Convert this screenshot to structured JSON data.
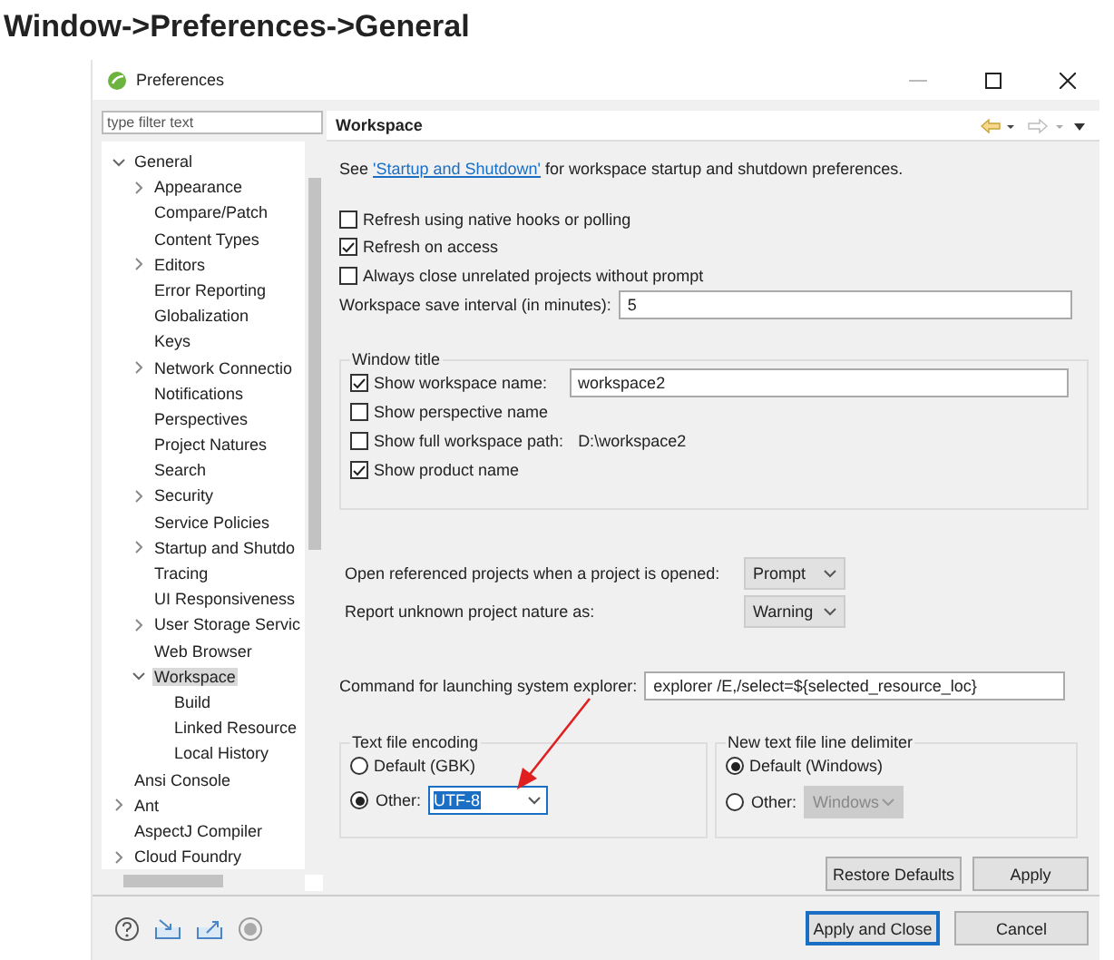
{
  "heading": "Window->Preferences->General",
  "window": {
    "title": "Preferences"
  },
  "filter": {
    "placeholder": "type filter text"
  },
  "tree": [
    {
      "label": "General",
      "expanded": true,
      "selected": false,
      "children": [
        {
          "label": "Appearance",
          "expanded": false,
          "selected": false,
          "has_children": true
        },
        {
          "label": "Compare/Patch",
          "selected": false
        },
        {
          "label": "Content Types",
          "selected": false
        },
        {
          "label": "Editors",
          "expanded": false,
          "selected": false,
          "has_children": true
        },
        {
          "label": "Error Reporting",
          "selected": false
        },
        {
          "label": "Globalization",
          "selected": false
        },
        {
          "label": "Keys",
          "selected": false
        },
        {
          "label": "Network Connectio",
          "expanded": false,
          "selected": false,
          "has_children": true
        },
        {
          "label": "Notifications",
          "selected": false
        },
        {
          "label": "Perspectives",
          "selected": false
        },
        {
          "label": "Project Natures",
          "selected": false
        },
        {
          "label": "Search",
          "selected": false
        },
        {
          "label": "Security",
          "expanded": false,
          "selected": false,
          "has_children": true
        },
        {
          "label": "Service Policies",
          "selected": false
        },
        {
          "label": "Startup and Shutdo",
          "expanded": false,
          "selected": false,
          "has_children": true
        },
        {
          "label": "Tracing",
          "selected": false
        },
        {
          "label": "UI Responsiveness",
          "selected": false
        },
        {
          "label": "User Storage Servic",
          "expanded": false,
          "selected": false,
          "has_children": true
        },
        {
          "label": "Web Browser",
          "selected": false
        },
        {
          "label": "Workspace",
          "expanded": true,
          "selected": true,
          "children": [
            {
              "label": "Build",
              "selected": false
            },
            {
              "label": "Linked Resource",
              "selected": false
            },
            {
              "label": "Local History",
              "selected": false
            }
          ]
        }
      ]
    },
    {
      "label": "Ansi Console",
      "selected": false
    },
    {
      "label": "Ant",
      "expanded": false,
      "selected": false,
      "has_children": true
    },
    {
      "label": "AspectJ Compiler",
      "selected": false
    },
    {
      "label": "Cloud Foundry",
      "expanded": false,
      "selected": false,
      "has_children": true
    }
  ],
  "page": {
    "title": "Workspace",
    "description": {
      "before": "See ",
      "link": "'Startup and Shutdown'",
      "after": " for workspace startup and shutdown preferences."
    },
    "options": [
      {
        "label": "Refresh using native hooks or polling",
        "checked": false
      },
      {
        "label": "Refresh on access",
        "checked": true
      },
      {
        "label": "Always close unrelated projects without prompt",
        "checked": false
      }
    ],
    "save_interval": {
      "label": "Workspace save interval (in minutes):",
      "value": "5"
    },
    "window_title": {
      "title": "Window title",
      "show_workspace_name": {
        "label": "Show workspace name:",
        "checked": true,
        "value": "workspace2"
      },
      "show_perspective_name": {
        "label": "Show perspective name",
        "checked": false
      },
      "show_full_path": {
        "label": "Show full workspace path:",
        "checked": false,
        "path": "D:\\workspace2"
      },
      "show_product_name": {
        "label": "Show product name",
        "checked": true
      }
    },
    "open_referenced": {
      "label": "Open referenced projects when a project is opened:",
      "value": "Prompt"
    },
    "unknown_nature": {
      "label": "Report unknown project nature as:",
      "value": "Warning"
    },
    "explorer_command": {
      "label": "Command for launching system explorer:",
      "value": "explorer /E,/select=${selected_resource_loc}"
    },
    "encoding": {
      "title": "Text file encoding",
      "default_label": "Default (GBK)",
      "default_selected": false,
      "other_label": "Other:",
      "other_selected": true,
      "other_value": "UTF-8",
      "other_disabled": false
    },
    "delimiter": {
      "title": "New text file line delimiter",
      "default_label": "Default (Windows)",
      "default_selected": true,
      "other_label": "Other:",
      "other_selected": false,
      "other_value": "Windows",
      "other_disabled": true
    },
    "buttons": [
      "Restore Defaults",
      "Apply"
    ]
  },
  "footer_buttons": [
    {
      "label": "Apply and Close",
      "default": true
    },
    {
      "label": "Cancel",
      "default": false
    }
  ]
}
